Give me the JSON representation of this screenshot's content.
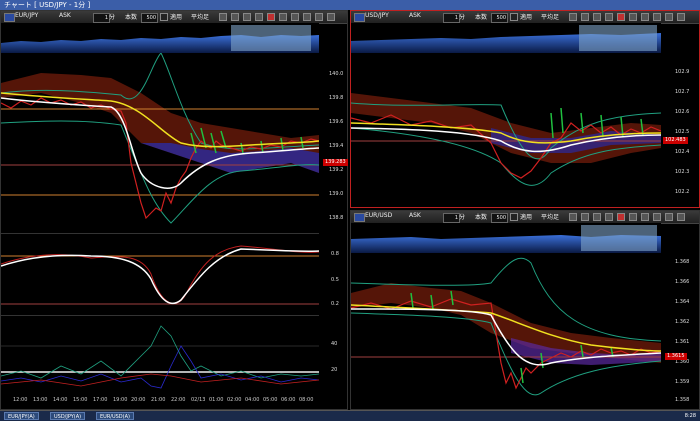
{
  "window": {
    "title": "チャート [ USD/JPY - 1分 ]"
  },
  "panes": {
    "left": {
      "symbol": "EUR/JPY",
      "ask": "ASK",
      "period_value": "1",
      "period_unit": "分",
      "count_label": "本数",
      "count_value": "500",
      "apply_label": "適用",
      "average_label": "平均足",
      "price_axis": [
        "140.0",
        "139.8",
        "139.6",
        "139.4",
        "139.2",
        "139.0",
        "138.8"
      ],
      "price_tag": "139.283",
      "osc1_axis": [
        "0.8",
        "0.5",
        "0.2"
      ],
      "osc2_axis": [
        "40",
        "20"
      ],
      "time_axis": [
        "12:00",
        "13:00",
        "14:00",
        "15:00",
        "17:00",
        "19:00",
        "20:00",
        "21:00",
        "22:00",
        "02/13",
        "01:00",
        "02:00",
        "04:00",
        "05:00",
        "06:00",
        "08:00"
      ]
    },
    "right_top": {
      "symbol": "USD/JPY",
      "ask": "ASK",
      "period_value": "1",
      "period_unit": "分",
      "count_label": "本数",
      "count_value": "500",
      "apply_label": "適用",
      "average_label": "平均足",
      "price_axis": [
        "102.9",
        "102.7",
        "102.6",
        "102.5",
        "102.4",
        "102.3",
        "102.2"
      ],
      "price_tag": "102.483"
    },
    "right_bottom": {
      "symbol": "EUR/USD",
      "ask": "ASK",
      "period_value": "1",
      "period_unit": "分",
      "count_label": "本数",
      "count_value": "500",
      "apply_label": "適用",
      "average_label": "平均足",
      "price_axis": [
        "1.368",
        "1.366",
        "1.364",
        "1.362",
        "1.361",
        "1.360",
        "1.359",
        "1.358"
      ],
      "price_tag": "1.3615"
    }
  },
  "taskbar": {
    "tabs": [
      "EUR/JPY(A)",
      "USD/JPY(A)",
      "EUR/USD(A)"
    ],
    "clock": "8:28"
  },
  "colors": {
    "accent_border": "#c02020",
    "titlebar": "#3b5ea8",
    "price_tag": "#cc0000"
  }
}
